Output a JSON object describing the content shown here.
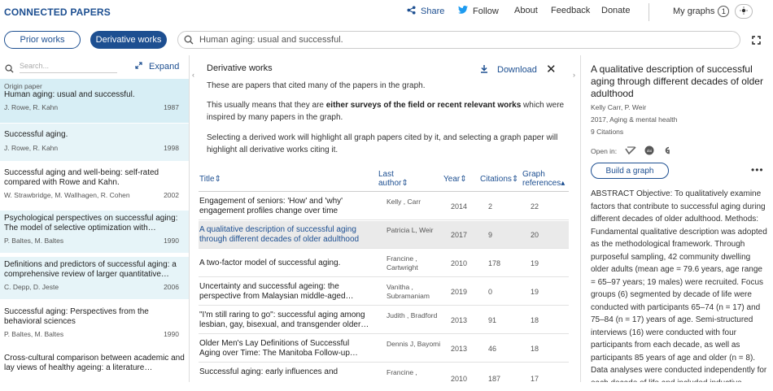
{
  "header": {
    "brand": "CONNECTED PAPERS",
    "share": "Share",
    "follow": "Follow",
    "about": "About",
    "feedback": "Feedback",
    "donate": "Donate",
    "my_graphs": "My graphs",
    "my_graphs_count": "1"
  },
  "tabs": {
    "prior": "Prior works",
    "derivative": "Derivative works"
  },
  "search": {
    "value": "Human aging: usual and successful."
  },
  "left": {
    "search_placeholder": "Search...",
    "expand": "Expand",
    "origin_label": "Origin paper",
    "items": [
      {
        "title": "Human aging: usual and successful.",
        "authors": "J. Rowe, R. Kahn",
        "year": "1987"
      },
      {
        "title": "Successful aging.",
        "authors": "J. Rowe, R. Kahn",
        "year": "1998"
      },
      {
        "title": "Successful aging and well-being: self-rated compared with Rowe and Kahn.",
        "authors": "W. Strawbridge, M. Wallhagen, R. Cohen",
        "year": "2002"
      },
      {
        "title": "Psychological perspectives on successful aging: The model of selective optimization with…",
        "authors": "P. Baltes, M. Baltes",
        "year": "1990"
      },
      {
        "title": "Definitions and predictors of successful aging: a comprehensive review of larger quantitative…",
        "authors": "C. Depp, D. Jeste",
        "year": "2006"
      },
      {
        "title": "Successful aging: Perspectives from the behavioral sciences",
        "authors": "P. Baltes, M. Baltes",
        "year": "1990"
      },
      {
        "title": "Cross-cultural comparison between academic and lay views of healthy ageing: a literature…",
        "authors": "",
        "year": ""
      }
    ]
  },
  "middle": {
    "heading": "Derivative works",
    "download": "Download",
    "p1": "These are papers that cited many of the papers in the graph.",
    "p2_a": "This usually means that they are ",
    "p2_bold": "either surveys of the field or recent relevant works",
    "p2_b": " which were inspired by many papers in the graph.",
    "p3": "Selecting a derived work will highlight all graph papers cited by it, and selecting a graph paper will highlight all derivative works citing it.",
    "columns": {
      "title": "Title",
      "last_author_1": "Last",
      "last_author_2": "author",
      "year": "Year",
      "citations": "Citations",
      "graph_refs_1": "Graph",
      "graph_refs_2": "references"
    },
    "rows": [
      {
        "title": "Engagement of seniors: 'How' and 'why' engagement profiles change over time",
        "author": "Kelly , Carr",
        "year": "2014",
        "citations": "2",
        "refs": "22"
      },
      {
        "title": "A qualitative description of successful aging through different decades of older adulthood",
        "author": "Patricia L, Weir",
        "year": "2017",
        "citations": "9",
        "refs": "20"
      },
      {
        "title": "A two-factor model of successful aging.",
        "author": "Francine , Cartwright",
        "year": "2010",
        "citations": "178",
        "refs": "19"
      },
      {
        "title": "Uncertainty and successful ageing: the perspective from Malaysian middle-aged…",
        "author": "Vanitha , Subramaniam",
        "year": "2019",
        "citations": "0",
        "refs": "19"
      },
      {
        "title": "\"I'm still raring to go\": successful aging among lesbian, gay, bisexual, and transgender older…",
        "author": "Judith , Bradford",
        "year": "2013",
        "citations": "91",
        "refs": "18"
      },
      {
        "title": "Older Men's Lay Definitions of Successful Aging over Time: The Manitoba Follow-up…",
        "author": "Dennis J, Bayomi",
        "year": "2013",
        "citations": "46",
        "refs": "18"
      },
      {
        "title": "Successful aging: early influences and",
        "author": "Francine ,",
        "year": "2010",
        "citations": "187",
        "refs": "17"
      }
    ]
  },
  "right": {
    "title": "A qualitative description of successful aging through different decades of older adulthood",
    "authors": "Kelly Carr, P. Weir",
    "venue": "2017, Aging & mental health",
    "citations": "9 Citations",
    "open_in": "Open in:",
    "build_graph": "Build a graph",
    "abstract": "ABSTRACT Objective: To qualitatively examine factors that contribute to successful aging during different decades of older adulthood. Methods: Fundamental qualitative description was adopted as the methodological framework. Through purposeful sampling, 42 community dwelling older adults (mean age = 79.6 years, age range = 65–97 years; 19 males) were recruited. Focus groups (6) segmented by decade of life were conducted with participants 65–74 (n = 17) and 75–84 (n = 17) years of age. Semi-structured interviews (16) were conducted with four participants from each decade, as well as participants 85 years of age and older (n = 8). Data analyses were conducted independently for each decade of life and included inductive"
  }
}
